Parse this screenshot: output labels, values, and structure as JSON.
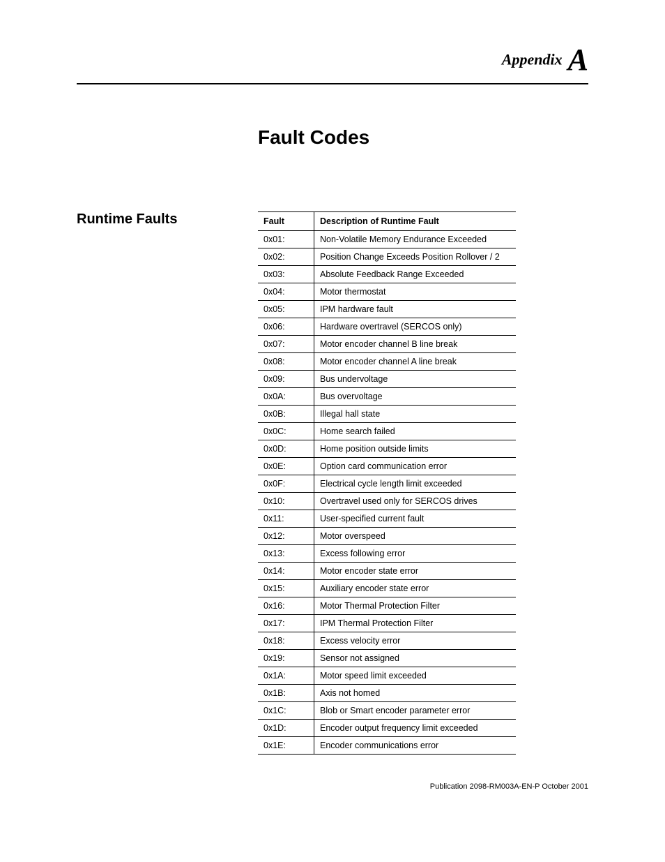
{
  "appendix": {
    "label": "Appendix",
    "letter": "A"
  },
  "title": "Fault Codes",
  "section": "Runtime Faults",
  "table": {
    "headers": {
      "fault": "Fault",
      "desc": "Description of Runtime Fault"
    },
    "rows": [
      {
        "code": "0x01:",
        "desc": "Non-Volatile Memory Endurance Exceeded"
      },
      {
        "code": "0x02:",
        "desc": "Position Change Exceeds Position Rollover / 2"
      },
      {
        "code": "0x03:",
        "desc": "Absolute Feedback Range Exceeded"
      },
      {
        "code": "0x04:",
        "desc": "Motor thermostat"
      },
      {
        "code": "0x05:",
        "desc": "IPM hardware fault"
      },
      {
        "code": "0x06:",
        "desc": "Hardware overtravel (SERCOS only)"
      },
      {
        "code": "0x07:",
        "desc": "Motor encoder channel B line break"
      },
      {
        "code": "0x08:",
        "desc": "Motor encoder channel A line break"
      },
      {
        "code": "0x09:",
        "desc": "Bus undervoltage"
      },
      {
        "code": "0x0A:",
        "desc": "Bus overvoltage"
      },
      {
        "code": "0x0B:",
        "desc": "Illegal hall state"
      },
      {
        "code": "0x0C:",
        "desc": "Home search failed"
      },
      {
        "code": "0x0D:",
        "desc": "Home position outside limits"
      },
      {
        "code": "0x0E:",
        "desc": "Option card communication error"
      },
      {
        "code": "0x0F:",
        "desc": "Electrical cycle length limit exceeded"
      },
      {
        "code": "0x10:",
        "desc": "Overtravel used only for SERCOS drives"
      },
      {
        "code": "0x11:",
        "desc": "User-specified current fault"
      },
      {
        "code": "0x12:",
        "desc": "Motor overspeed"
      },
      {
        "code": "0x13:",
        "desc": "Excess following error"
      },
      {
        "code": "0x14:",
        "desc": "Motor encoder state error"
      },
      {
        "code": "0x15:",
        "desc": "Auxiliary encoder state error"
      },
      {
        "code": "0x16:",
        "desc": "Motor Thermal Protection Filter"
      },
      {
        "code": "0x17:",
        "desc": "IPM Thermal Protection Filter"
      },
      {
        "code": "0x18:",
        "desc": "Excess velocity error"
      },
      {
        "code": "0x19:",
        "desc": "Sensor not assigned"
      },
      {
        "code": "0x1A:",
        "desc": "Motor speed limit exceeded"
      },
      {
        "code": "0x1B:",
        "desc": "Axis not homed"
      },
      {
        "code": "0x1C:",
        "desc": "Blob or Smart encoder parameter error"
      },
      {
        "code": "0x1D:",
        "desc": "Encoder output frequency limit exceeded"
      },
      {
        "code": "0x1E:",
        "desc": "Encoder communications error"
      }
    ]
  },
  "footer": "Publication 2098-RM003A-EN-P October 2001"
}
